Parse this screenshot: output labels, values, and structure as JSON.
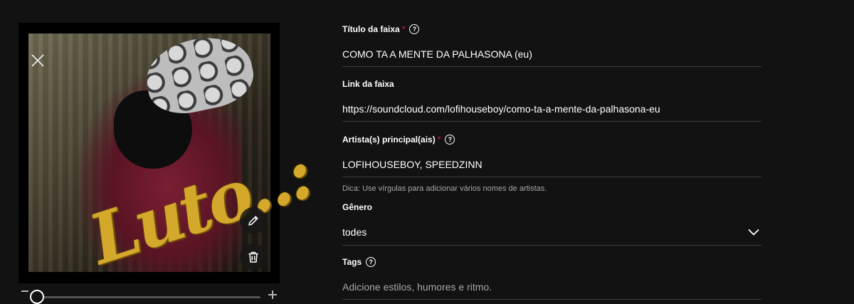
{
  "artwork": {
    "overlay_text": "Luto..:",
    "edit_icon": "pencil-icon",
    "delete_icon": "trash-icon",
    "close_icon": "close-icon"
  },
  "zoom": {
    "minus": "−",
    "plus": "+",
    "value": 0
  },
  "form": {
    "title": {
      "label": "Título da faixa",
      "required_mark": "*",
      "value": "COMO TA A MENTE DA PALHASONA (eu)"
    },
    "link": {
      "label": "Link da faixa",
      "value": "https://soundcloud.com/lofihouseboy/como-ta-a-mente-da-palhasona-eu"
    },
    "artists": {
      "label": "Artista(s) principal(ais)",
      "required_mark": "*",
      "value": "LOFIHOUSEBOY, SPEEDZINN",
      "hint": "Dica: Use vírgulas para adicionar vários nomes de artistas."
    },
    "genre": {
      "label": "Gênero",
      "value": "todes"
    },
    "tags": {
      "label": "Tags",
      "placeholder": "Adicione estilos, humores e ritmo."
    }
  },
  "colors": {
    "background": "#121212",
    "required": "#e22134",
    "divider": "#3e3e3e"
  }
}
